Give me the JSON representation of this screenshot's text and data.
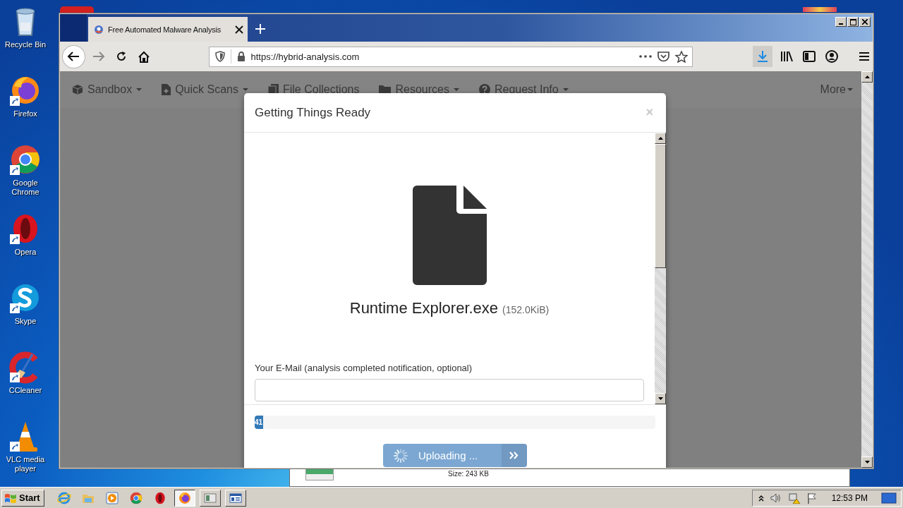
{
  "desktop_icons": [
    {
      "kind": "recycle",
      "label": "Recycle Bin",
      "shortcut": false
    },
    {
      "kind": "firefox",
      "label": "Firefox",
      "shortcut": true
    },
    {
      "kind": "chrome",
      "label": "Google Chrome",
      "shortcut": true
    },
    {
      "kind": "opera",
      "label": "Opera",
      "shortcut": true
    },
    {
      "kind": "skype",
      "label": "Skype",
      "shortcut": true
    },
    {
      "kind": "ccleaner",
      "label": "CCleaner",
      "shortcut": true
    },
    {
      "kind": "vlc",
      "label": "VLC media player",
      "shortcut": true
    }
  ],
  "background_window": {
    "size_text": "Size: 243 KB"
  },
  "browser": {
    "tabs": [
      {
        "title": "Free Automated Malware Analysis",
        "selected": true
      }
    ],
    "url": "https://hybrid-analysis.com",
    "site_nav": [
      {
        "kind": "cube",
        "label": "Sandbox",
        "caret": true
      },
      {
        "kind": "file",
        "label": "Quick Scans",
        "caret": true
      },
      {
        "kind": "files",
        "label": "File Collections",
        "caret": false
      },
      {
        "kind": "folder",
        "label": "Resources",
        "caret": true
      },
      {
        "kind": "help",
        "label": "Request Info",
        "caret": true
      },
      {
        "kind": "none",
        "label": "More",
        "caret": true
      }
    ],
    "dialog": {
      "title": "Getting Things Ready",
      "close": "×",
      "file_name": "Runtime Explorer.exe",
      "file_size": "(152.0KiB)",
      "email_label": "Your E-Mail (analysis completed notification, optional)",
      "progress": {
        "level": 0.022,
        "label": "41"
      },
      "button": {
        "label": "Uploading ...",
        "disabled": true
      }
    }
  },
  "taskbar": {
    "start": "Start",
    "items": [
      {
        "kind": "ie",
        "selected": false
      },
      {
        "kind": "folder",
        "selected": false
      },
      {
        "kind": "media",
        "selected": false
      },
      {
        "kind": "chrome",
        "selected": false
      },
      {
        "kind": "opera",
        "selected": false
      },
      {
        "kind": "firefox",
        "selected": true
      },
      {
        "kind": "window",
        "selected": false
      },
      {
        "kind": "window2",
        "selected": false
      }
    ],
    "clock": "12:53 PM"
  }
}
